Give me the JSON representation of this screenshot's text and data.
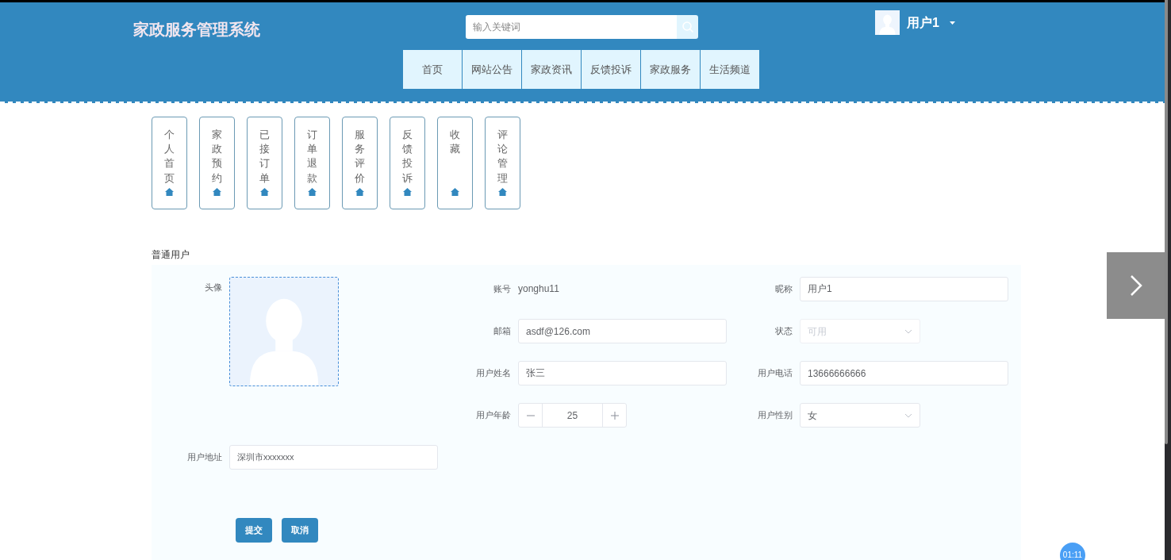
{
  "header": {
    "title": "家政服务管理系统",
    "search": {
      "placeholder": "输入关键词"
    },
    "user": {
      "name": "用户1"
    },
    "nav": [
      {
        "label": "首页",
        "selected": false
      },
      {
        "label": "网站公告",
        "selected": false
      },
      {
        "label": "家政资讯",
        "selected": false
      },
      {
        "label": "反馈投诉",
        "selected": false
      },
      {
        "label": "家政服务",
        "selected": false
      },
      {
        "label": "生活频道",
        "selected": false
      }
    ]
  },
  "side_menu": [
    {
      "label": "个人首页"
    },
    {
      "label": "家政预约"
    },
    {
      "label": "已接订单"
    },
    {
      "label": "订单退款"
    },
    {
      "label": "服务评价"
    },
    {
      "label": "反馈投诉"
    },
    {
      "label": "收藏"
    },
    {
      "label": "评论管理"
    }
  ],
  "profile": {
    "section_title": "普通用户",
    "avatar_label": "头像",
    "fields": [
      {
        "kind": "text",
        "label": "账号",
        "value": "yonghu11"
      },
      {
        "kind": "input",
        "label": "昵称",
        "value": "用户1"
      },
      {
        "kind": "input",
        "label": "邮箱",
        "value": "asdf@126.com"
      },
      {
        "kind": "select",
        "label": "状态",
        "value": "可用",
        "disabled": true
      },
      {
        "kind": "input",
        "label": "用户姓名",
        "value": "张三"
      },
      {
        "kind": "input",
        "label": "用户电话",
        "value": "13666666666"
      },
      {
        "kind": "stepper",
        "label": "用户年龄",
        "value": "25"
      },
      {
        "kind": "select",
        "label": "用户性别",
        "value": "女",
        "disabled": false
      }
    ],
    "address": {
      "label": "用户地址",
      "value": "深圳市xxxxxxx"
    },
    "buttons": [
      {
        "label": "提交"
      },
      {
        "label": "取消"
      }
    ]
  },
  "timer": "01:11"
}
